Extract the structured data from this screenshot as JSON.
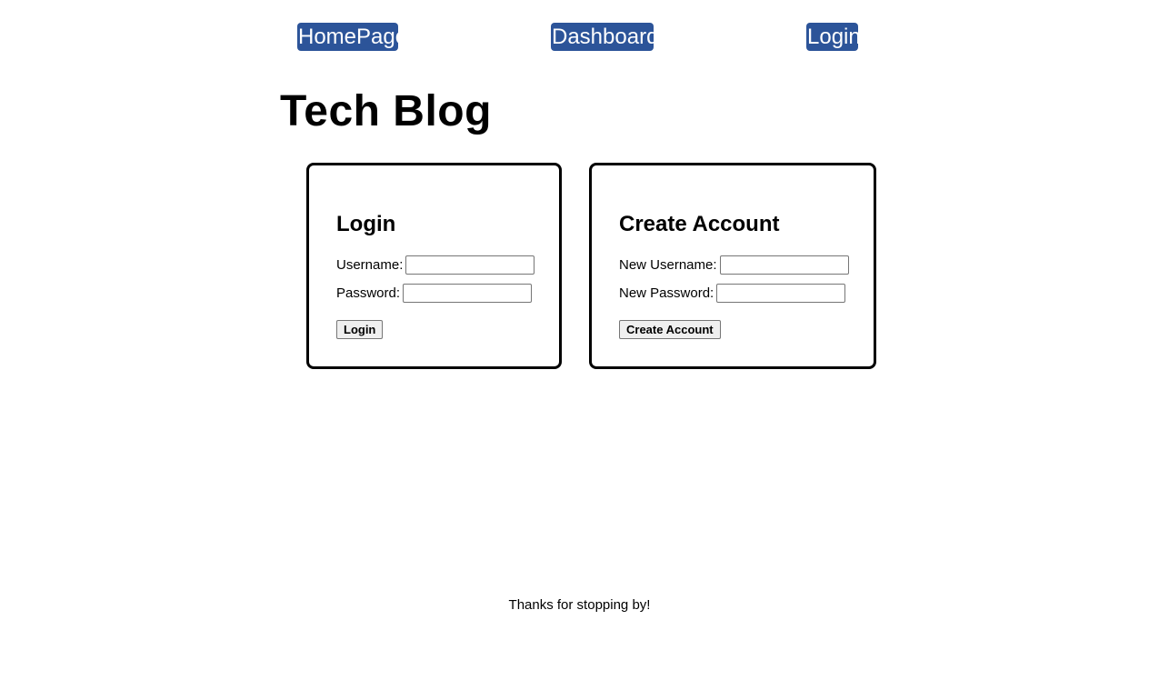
{
  "nav": {
    "home_label": "HomePage",
    "dashboard_label": "Dashboard",
    "login_label": "Login"
  },
  "site_title": "Tech Blog",
  "login_form": {
    "title": "Login",
    "username_label": "Username:",
    "username_value": "",
    "password_label": "Password:",
    "password_value": "",
    "submit_label": "Login"
  },
  "signup_form": {
    "title": "Create Account",
    "username_label": "New Username:",
    "username_value": "",
    "password_label": "New Password:",
    "password_value": "",
    "submit_label": "Create Account"
  },
  "footer": {
    "text": "Thanks for stopping by!"
  },
  "colors": {
    "nav_background": "#2c5499",
    "nav_text": "#ffffff",
    "card_border": "#000000",
    "page_background": "#ffffff"
  }
}
